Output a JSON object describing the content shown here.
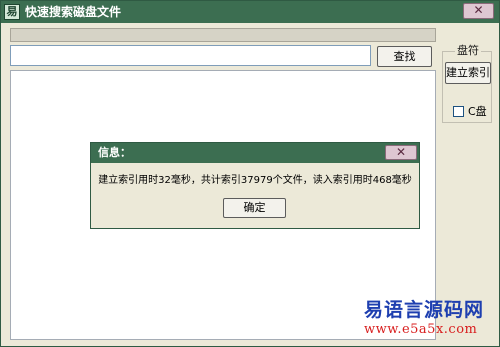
{
  "window": {
    "title": "快速搜索磁盘文件",
    "close_glyph": "✕"
  },
  "search": {
    "value": "",
    "placeholder": "",
    "button_label": "查找"
  },
  "drive_panel": {
    "legend": "盘符",
    "build_index_label": "建立索引",
    "drive_c_label": "C盘",
    "drive_c_checked": false
  },
  "dialog": {
    "title": "信息：",
    "close_glyph": "✕",
    "message": "建立索引用时32毫秒，共计索引37979个文件，读入索引用时468毫秒",
    "ok_label": "确定"
  },
  "watermark": {
    "brand": "易语言源码网",
    "url": "www.e5a5x.com"
  },
  "colors": {
    "titlebar": "#3c6e51",
    "window_bg": "#ece9d8",
    "watermark_brand": "#1e3fb0",
    "watermark_url": "#d81e1e"
  }
}
